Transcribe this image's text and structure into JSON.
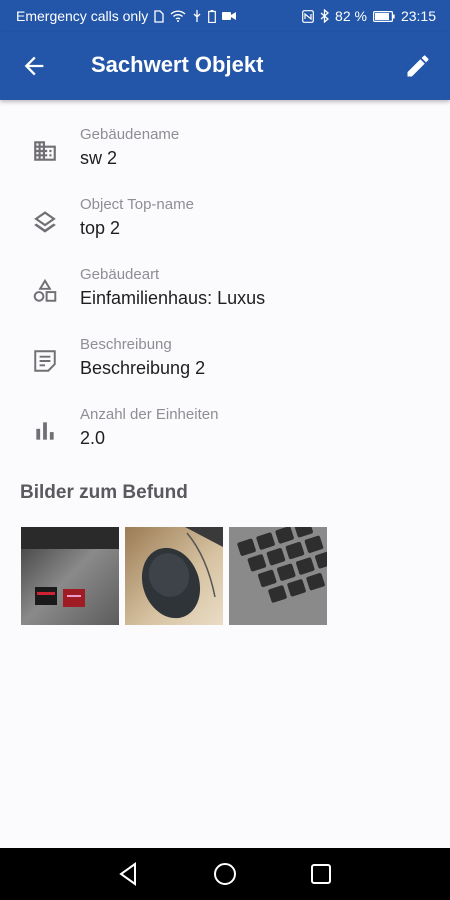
{
  "status_bar": {
    "carrier": "Emergency calls only",
    "battery": "82 %",
    "time": "23:15"
  },
  "app_bar": {
    "title": "Sachwert Objekt",
    "back_icon": "arrow-back-icon",
    "edit_icon": "pencil-icon"
  },
  "details": [
    {
      "icon": "building-icon",
      "label": "Gebäudename",
      "value": "sw 2"
    },
    {
      "icon": "layers-icon",
      "label": "Object Top-name",
      "value": "top 2"
    },
    {
      "icon": "shapes-icon",
      "label": "Gebäudeart",
      "value": "Einfamilienhaus: Luxus"
    },
    {
      "icon": "note-icon",
      "label": "Beschreibung",
      "value": "Beschreibung 2"
    },
    {
      "icon": "bar-chart-icon",
      "label": "Anzahl der Einheiten",
      "value": "2.0"
    }
  ],
  "images_section": {
    "title": "Bilder zum Befund",
    "images": [
      "laptop-with-stickers-photo",
      "mouse-on-desk-photo",
      "keyboard-photo"
    ]
  },
  "colors": {
    "primary": "#2356a8",
    "background": "#fbfafd",
    "label": "#8e8e94",
    "value": "#1e1e1e"
  }
}
